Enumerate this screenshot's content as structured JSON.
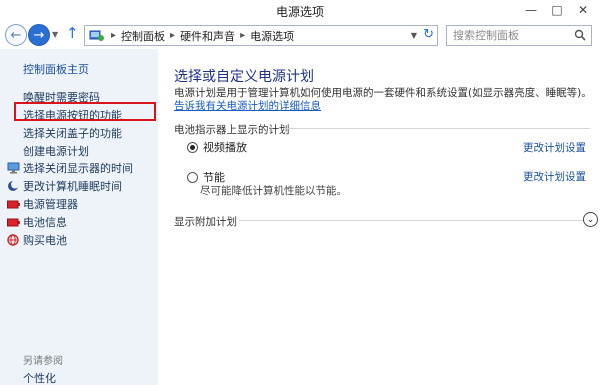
{
  "window": {
    "title": "电源选项",
    "minimize_glyph": "—",
    "maximize_glyph": "□",
    "close_glyph": "✕"
  },
  "navbar": {
    "back_glyph": "←",
    "forward_glyph": "→",
    "history_glyph": "▼",
    "up_glyph": "↑",
    "breadcrumb": [
      "控制面板",
      "硬件和声音",
      "电源选项"
    ],
    "crumb_sep": "▸",
    "dropdown_glyph": "▼",
    "refresh_glyph": "↻",
    "search_placeholder": "搜索控制面板"
  },
  "sidebar": {
    "home": "控制面板主页",
    "links": [
      "唤醒时需要密码",
      "选择电源按钮的功能",
      "选择关闭盖子的功能",
      "创建电源计划"
    ],
    "icon_links": [
      {
        "label": "选择关闭显示器的时间",
        "icon": "monitor-icon"
      },
      {
        "label": "更改计算机睡眠时间",
        "icon": "moon-icon"
      },
      {
        "label": "电源管理器",
        "icon": "battery-icon"
      },
      {
        "label": "电池信息",
        "icon": "battery-icon"
      },
      {
        "label": "购买电池",
        "icon": "globe-icon"
      }
    ],
    "see_also": "另请参阅",
    "personalize": "个性化"
  },
  "main": {
    "title": "选择或自定义电源计划",
    "desc_text": "电源计划是用于管理计算机如何使用电源的一套硬件和系统设置(如显示器亮度、睡眠等)。",
    "desc_link": "告诉我有关电源计划的详细信息",
    "battery_section": "电池指示器上显示的计划",
    "plans": [
      {
        "name": "视频播放",
        "selected": true,
        "desc": "",
        "change": "更改计划设置"
      },
      {
        "name": "节能",
        "selected": false,
        "desc": "尽可能降低计算机性能以节能。",
        "change": "更改计划设置"
      }
    ],
    "more_plans": "显示附加计划",
    "expand_glyph": "⌄"
  },
  "colors": {
    "sidebar_bg": "#eef3fa",
    "title_blue": "#1e3287",
    "link_blue": "#1a4f9e",
    "highlight_red": "#d9141b"
  }
}
